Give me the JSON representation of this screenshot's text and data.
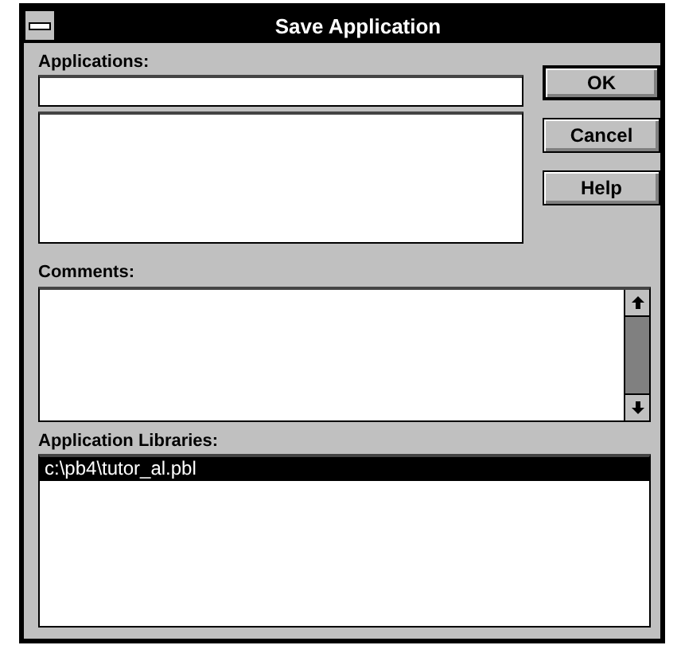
{
  "window": {
    "title": "Save Application"
  },
  "applications": {
    "label": "Applications:"
  },
  "comments": {
    "label": "Comments:"
  },
  "libraries": {
    "label": "Application Libraries:",
    "items": [
      {
        "text": "c:\\pb4\\tutor_al.pbl",
        "selected": true
      }
    ]
  },
  "buttons": [
    {
      "label": "OK",
      "default": true
    },
    {
      "label": "Cancel",
      "default": false
    },
    {
      "label": "Help",
      "default": false
    }
  ]
}
